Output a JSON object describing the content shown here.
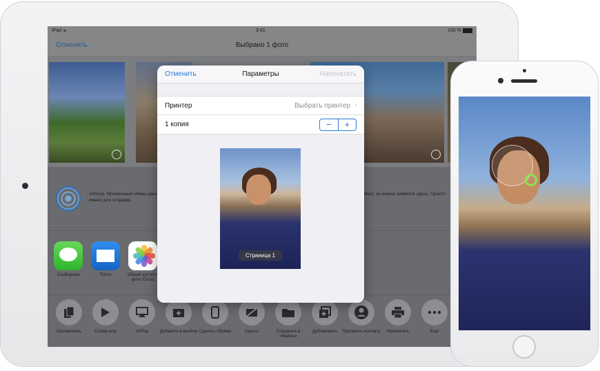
{
  "statusbar": {
    "device": "iPad",
    "time": "9:41",
    "battery": "100 %"
  },
  "nav": {
    "cancel": "Отменить",
    "title": "Выбрано 1 фото"
  },
  "airdrop": {
    "text_left": "AirDrop. Мгновенный обмен данн... коснитесь имени для отправки.",
    "text_right": "r (Mac), их имена появятся здесь. Просто"
  },
  "apps": [
    {
      "label": "Сообщение",
      "icon": "messages-icon"
    },
    {
      "label": "Почта",
      "icon": "mail-icon"
    },
    {
      "label": "Общий доступ к фото iCloud",
      "icon": "photos-icon"
    }
  ],
  "actions": [
    {
      "label": "Скопировать",
      "icon": "copy-icon"
    },
    {
      "label": "Слайд-шоу",
      "icon": "play-icon"
    },
    {
      "label": "AirPlay",
      "icon": "airplay-icon"
    },
    {
      "label": "Добавить в альбом",
      "icon": "add-album-icon"
    },
    {
      "label": "Сделать обоями",
      "icon": "wallpaper-icon"
    },
    {
      "label": "Скрыть",
      "icon": "hide-icon"
    },
    {
      "label": "Сохранить в «Файлы»",
      "icon": "folder-icon"
    },
    {
      "label": "Дублировать",
      "icon": "duplicate-icon"
    },
    {
      "label": "Присвоить контакту",
      "icon": "contact-icon"
    },
    {
      "label": "Напечатать",
      "icon": "printer-icon"
    },
    {
      "label": "Еще",
      "icon": "more-icon"
    }
  ],
  "dialog": {
    "cancel": "Отменить",
    "title": "Параметры",
    "print": "Напечатать",
    "printer_label": "Принтер",
    "printer_value": "Выбрать принтер",
    "copies_label": "1 копия",
    "minus": "−",
    "plus": "+",
    "page_badge": "Страница 1"
  },
  "colors": {
    "accent": "#2b7ad6",
    "dim_overlay": "#6e6f71"
  }
}
